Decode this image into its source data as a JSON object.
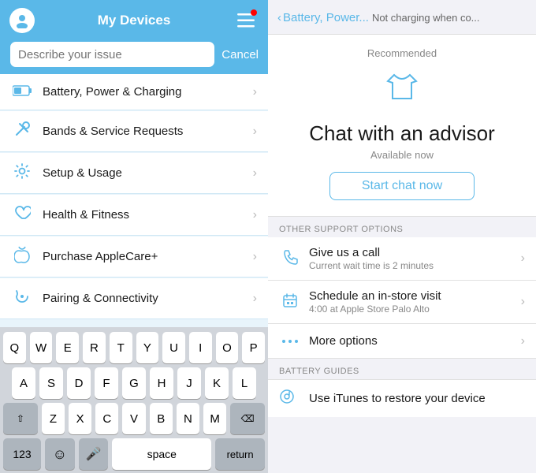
{
  "left": {
    "header": {
      "title": "My Devices"
    },
    "search": {
      "placeholder": "Describe your issue",
      "cancel_label": "Cancel"
    },
    "menu_items": [
      {
        "id": "battery",
        "label": "Battery, Power & Charging",
        "icon": "🔋"
      },
      {
        "id": "bands",
        "label": "Bands & Service Requests",
        "icon": "🔧"
      },
      {
        "id": "setup",
        "label": "Setup & Usage",
        "icon": "⚙️"
      },
      {
        "id": "health",
        "label": "Health & Fitness",
        "icon": "❤️"
      },
      {
        "id": "applecare",
        "label": "Purchase AppleCare+",
        "icon": "🍎"
      },
      {
        "id": "pairing",
        "label": "Pairing & Connectivity",
        "icon": "🔄"
      }
    ],
    "keyboard": {
      "rows": [
        [
          "Q",
          "W",
          "E",
          "R",
          "T",
          "Y",
          "U",
          "I",
          "O",
          "P"
        ],
        [
          "A",
          "S",
          "D",
          "F",
          "G",
          "H",
          "J",
          "K",
          "L"
        ],
        [
          "Z",
          "X",
          "C",
          "V",
          "B",
          "N",
          "M"
        ]
      ],
      "bottom": {
        "num": "123",
        "space": "space",
        "return": "return"
      }
    }
  },
  "right": {
    "header": {
      "back_label": "Battery, Power...",
      "title": "Not charging when co..."
    },
    "recommended": {
      "label": "Recommended",
      "chat_title": "Chat with an advisor",
      "available": "Available now",
      "start_chat": "Start chat now"
    },
    "other_options": {
      "section_label": "OTHER SUPPORT OPTIONS",
      "items": [
        {
          "id": "call",
          "title": "Give us a call",
          "subtitle": "Current wait time is 2 minutes"
        },
        {
          "id": "store",
          "title": "Schedule an in-store visit",
          "subtitle": "4:00 at Apple Store Palo Alto"
        },
        {
          "id": "more",
          "title": "More options",
          "subtitle": ""
        }
      ]
    },
    "battery_guides": {
      "section_label": "BATTERY GUIDES",
      "items": [
        {
          "id": "itunes",
          "title": "Use iTunes to restore your device"
        }
      ]
    }
  }
}
